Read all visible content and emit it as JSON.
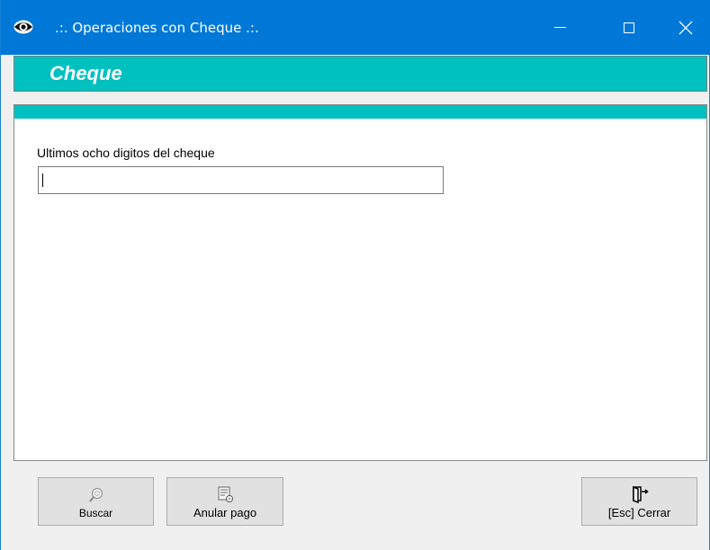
{
  "window": {
    "title": ".:. Operaciones con Cheque .:.",
    "icon": "eye-icon"
  },
  "header": {
    "title": "Cheque"
  },
  "form": {
    "label": "Ultimos ocho digitos del cheque",
    "value": ""
  },
  "buttons": {
    "buscar": {
      "label": "Buscar",
      "icon": "search-icon"
    },
    "anular": {
      "label": "Anular pago",
      "icon": "document-cancel-icon"
    },
    "cerrar": {
      "label": "[Esc] Cerrar",
      "icon": "exit-door-icon"
    }
  },
  "colors": {
    "titlebar": "#0078d7",
    "accent": "#00c0c0",
    "panel": "#ffffff",
    "button": "#e1e1e1"
  }
}
